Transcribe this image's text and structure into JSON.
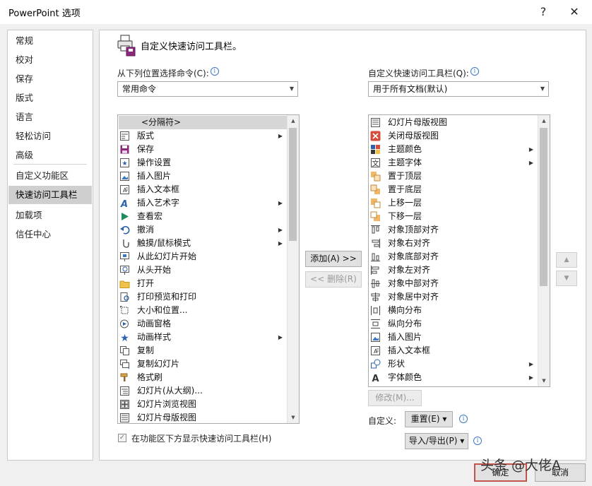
{
  "window": {
    "title": "PowerPoint 选项",
    "help_label": "?",
    "close_label": "✕"
  },
  "nav": {
    "items": [
      "常规",
      "校对",
      "保存",
      "版式",
      "语言",
      "轻松访问",
      "高级",
      "自定义功能区",
      "快速访问工具栏",
      "加载项",
      "信任中心"
    ],
    "selected": "快速访问工具栏"
  },
  "header": {
    "title": "自定义快速访问工具栏。"
  },
  "left": {
    "label": "从下列位置选择命令(C):",
    "combo_value": "常用命令",
    "items": [
      {
        "label": "<分隔符>",
        "icon": "separator",
        "submenu": false
      },
      {
        "label": "版式",
        "icon": "layout-icon",
        "submenu": true
      },
      {
        "label": "保存",
        "icon": "save-icon",
        "submenu": false
      },
      {
        "label": "操作设置",
        "icon": "action-settings-icon",
        "submenu": false
      },
      {
        "label": "插入图片",
        "icon": "insert-picture-icon",
        "submenu": false
      },
      {
        "label": "插入文本框",
        "icon": "textbox-icon",
        "submenu": false
      },
      {
        "label": "插入艺术字",
        "icon": "wordart-icon",
        "submenu": true
      },
      {
        "label": "查看宏",
        "icon": "macro-icon",
        "submenu": false
      },
      {
        "label": "撤消",
        "icon": "undo-icon",
        "submenu": true
      },
      {
        "label": "触摸/鼠标模式",
        "icon": "touch-mode-icon",
        "submenu": true
      },
      {
        "label": "从此幻灯片开始",
        "icon": "from-current-slide-icon",
        "submenu": false
      },
      {
        "label": "从头开始",
        "icon": "from-beginning-icon",
        "submenu": false
      },
      {
        "label": "打开",
        "icon": "open-folder-icon",
        "submenu": false
      },
      {
        "label": "打印预览和打印",
        "icon": "print-preview-icon",
        "submenu": false
      },
      {
        "label": "大小和位置...",
        "icon": "size-position-icon",
        "submenu": false
      },
      {
        "label": "动画窗格",
        "icon": "animation-pane-icon",
        "submenu": false
      },
      {
        "label": "动画样式",
        "icon": "animation-style-icon",
        "submenu": true
      },
      {
        "label": "复制",
        "icon": "copy-icon",
        "submenu": false
      },
      {
        "label": "复制幻灯片",
        "icon": "duplicate-slide-icon",
        "submenu": false
      },
      {
        "label": "格式刷",
        "icon": "format-painter-icon",
        "submenu": false
      },
      {
        "label": "幻灯片(从大纲)...",
        "icon": "slides-from-outline-icon",
        "submenu": false
      },
      {
        "label": "幻灯片浏览视图",
        "icon": "slide-sorter-icon",
        "submenu": false
      },
      {
        "label": "幻灯片母版视图",
        "icon": "slide-master-icon",
        "submenu": false
      }
    ],
    "show_below_label": "在功能区下方显示快速访问工具栏(H)"
  },
  "middle": {
    "add_label": "添加(A) >>",
    "remove_label": "<< 删除(R)"
  },
  "right": {
    "label": "自定义快速访问工具栏(Q):",
    "combo_value": "用于所有文档(默认)",
    "items": [
      {
        "label": "幻灯片母版视图",
        "icon": "slide-master-icon",
        "submenu": false
      },
      {
        "label": "关闭母版视图",
        "icon": "close-master-icon",
        "submenu": false
      },
      {
        "label": "主题颜色",
        "icon": "theme-colors-icon",
        "submenu": true
      },
      {
        "label": "主题字体",
        "icon": "theme-fonts-icon",
        "submenu": true
      },
      {
        "label": "置于顶层",
        "icon": "bring-to-front-icon",
        "submenu": false
      },
      {
        "label": "置于底层",
        "icon": "send-to-back-icon",
        "submenu": false
      },
      {
        "label": "上移一层",
        "icon": "bring-forward-icon",
        "submenu": false
      },
      {
        "label": "下移一层",
        "icon": "send-backward-icon",
        "submenu": false
      },
      {
        "label": "对象顶部对齐",
        "icon": "align-top-icon",
        "submenu": false
      },
      {
        "label": "对象右对齐",
        "icon": "align-right-icon",
        "submenu": false
      },
      {
        "label": "对象底部对齐",
        "icon": "align-bottom-icon",
        "submenu": false
      },
      {
        "label": "对象左对齐",
        "icon": "align-left-icon",
        "submenu": false
      },
      {
        "label": "对象中部对齐",
        "icon": "align-middle-icon",
        "submenu": false
      },
      {
        "label": "对象居中对齐",
        "icon": "align-center-icon",
        "submenu": false
      },
      {
        "label": "横向分布",
        "icon": "distribute-horizontal-icon",
        "submenu": false
      },
      {
        "label": "纵向分布",
        "icon": "distribute-vertical-icon",
        "submenu": false
      },
      {
        "label": "插入图片",
        "icon": "insert-picture-icon",
        "submenu": false
      },
      {
        "label": "插入文本框",
        "icon": "textbox-icon",
        "submenu": false
      },
      {
        "label": "形状",
        "icon": "shapes-icon",
        "submenu": true
      },
      {
        "label": "字体颜色",
        "icon": "font-color-icon",
        "submenu": true
      }
    ],
    "modify_label": "修改(M)...",
    "customize_label": "自定义:",
    "reset_label": "重置(E) ▾",
    "import_export_label": "导入/导出(P) ▾"
  },
  "footer": {
    "ok_label": "确定",
    "cancel_label": "取消",
    "watermark": "头条 @大佬A"
  },
  "colors": {
    "accent": "#3b78c4",
    "selection": "#cfcfcf",
    "ok_border": "#c2544b"
  }
}
